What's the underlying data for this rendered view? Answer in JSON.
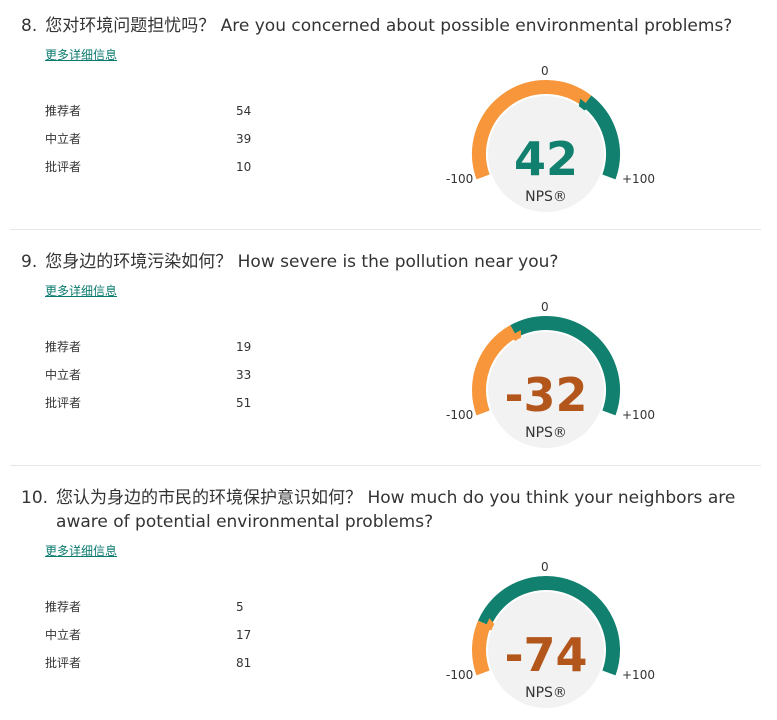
{
  "colors": {
    "teal": "#11806e",
    "orange": "#f7963a",
    "score_positive": "#11806e",
    "score_negative": "#b3561c",
    "link": "#0b7a6e"
  },
  "gauge_labels": {
    "zero": "0",
    "min": "-100",
    "max": "+100",
    "nps": "NPS®"
  },
  "questions": [
    {
      "number": "8.",
      "title": "您对环境问题担忧吗？ Are you concerned about possible environmental problems?",
      "more_link": "更多详细信息",
      "promoters_label": "推荐者",
      "promoters": "54",
      "passives_label": "中立者",
      "passives": "39",
      "detractors_label": "批评者",
      "detractors": "10",
      "nps": "42",
      "nps_value": 42,
      "score_color": "#11806e"
    },
    {
      "number": "9.",
      "title": "您身边的环境污染如何？ How severe is the pollution near you?",
      "more_link": "更多详细信息",
      "promoters_label": "推荐者",
      "promoters": "19",
      "passives_label": "中立者",
      "passives": "33",
      "detractors_label": "批评者",
      "detractors": "51",
      "nps": "-32",
      "nps_value": -32,
      "score_color": "#b3561c"
    },
    {
      "number": "10.",
      "title": "您认为身边的市民的环境保护意识如何？ How much do you think your neighbors are aware of potential environmental problems?",
      "more_link": "更多详细信息",
      "promoters_label": "推荐者",
      "promoters": "5",
      "passives_label": "中立者",
      "passives": "17",
      "detractors_label": "批评者",
      "detractors": "81",
      "nps": "-74",
      "nps_value": -74,
      "score_color": "#b3561c"
    }
  ]
}
